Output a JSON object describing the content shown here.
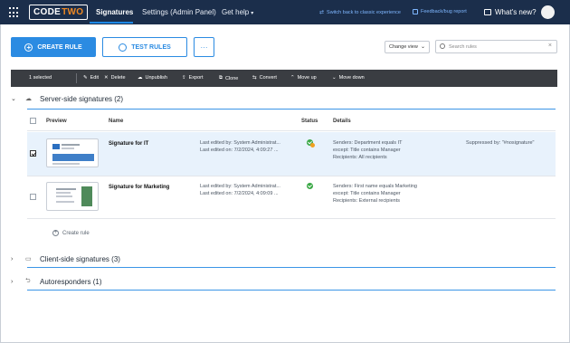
{
  "app": {
    "logo_code": "CODE",
    "logo_two": "TWO"
  },
  "nav": {
    "tabs": [
      "Signatures",
      "Settings (Admin Panel)",
      "Get help"
    ],
    "switch_link": "Switch back to classic experience",
    "feedback_link": "Feedback/bug report",
    "whats_new": "What's new?"
  },
  "actions": {
    "create_rule": "CREATE RULE",
    "test_rules": "TEST RULES",
    "more": "···",
    "change_view": "Change view",
    "search_placeholder": "Search rules"
  },
  "toolbar": {
    "selected": "1 selected",
    "items": [
      "Edit",
      "Delete",
      "Unpublish",
      "Export",
      "Clone",
      "Convert",
      "Move up",
      "Move down"
    ]
  },
  "groups": {
    "server": "Server-side signatures (2)",
    "client": "Client-side signatures (3)",
    "auto": "Autoresponders (1)"
  },
  "table": {
    "headers": [
      "Preview",
      "Name",
      "Status",
      "Details"
    ],
    "rows": [
      {
        "name": "Signature for IT",
        "edited_by": "Last edited by: System Administrat...",
        "edited_on": "Last edited on: 7/2/2024, 4:09:27 ...",
        "senders": "Senders: Department equals IT",
        "except": "except: Title contains Manager",
        "recipients": "Recipients: All recipients",
        "suppressed": "Suppressed by: \"#nosignature\"",
        "selected": true
      },
      {
        "name": "Signature for Marketing",
        "edited_by": "Last edited by: System Administrat...",
        "edited_on": "Last edited on: 7/2/2024, 4:09:09 ...",
        "senders": "Senders: First name equals Marketing",
        "except": "except: Title contains Manager",
        "recipients": "Recipients: External recipients",
        "selected": false
      }
    ],
    "create_rule": "Create rule"
  },
  "colors": {
    "topbar": "#1b2e4b",
    "accent": "#2b8be2",
    "toolbar": "#3a3d42",
    "status_ok": "#3aa845"
  }
}
